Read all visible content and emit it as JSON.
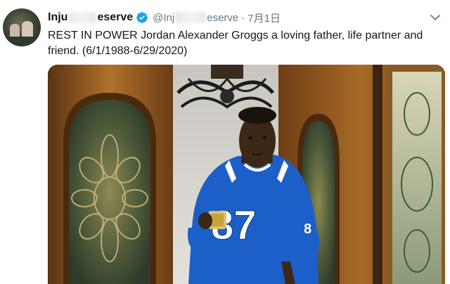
{
  "tweet": {
    "display_name_prefix": "Inju",
    "display_name_suffix": "eserve",
    "handle_prefix": "@Inj",
    "handle_suffix": "eserve",
    "separator": "·",
    "date": "7月1日",
    "text": "REST IN POWER Jordan Alexander Groggs a loving father, life partner and friend. (6/1/1988-6/29/2020)"
  },
  "icons": {
    "verified": "verified-badge-icon",
    "more": "chevron-down-icon"
  },
  "colors": {
    "verified_blue": "#1da1f2",
    "text": "#14171a",
    "secondary": "#657786",
    "jersey_blue": "#1c5fc9"
  },
  "photo": {
    "jersey_number": "87",
    "sleeve_number": "8"
  }
}
